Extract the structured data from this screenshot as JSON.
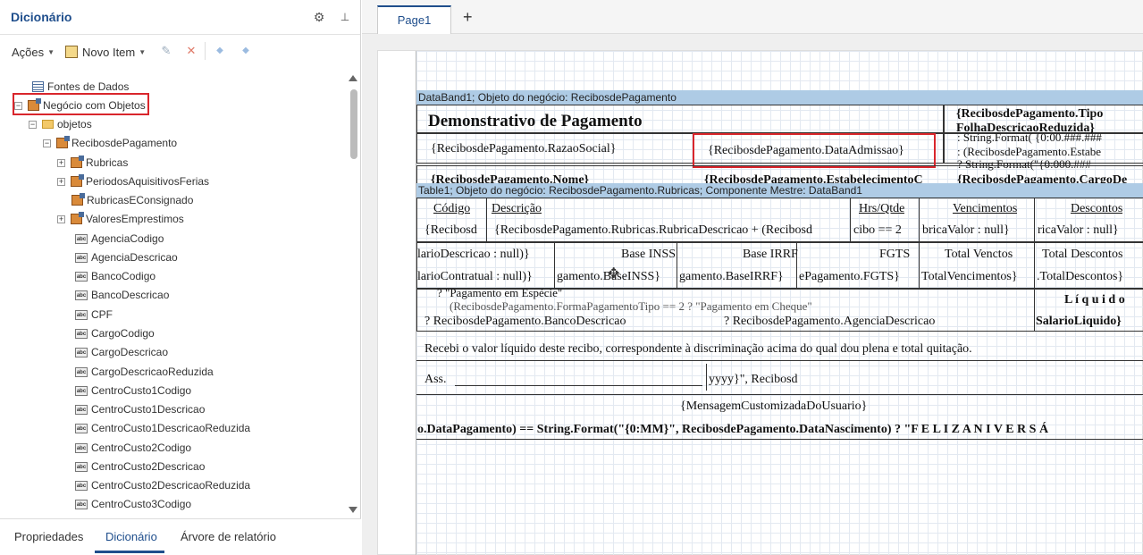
{
  "left_panel": {
    "title": "Dicionário",
    "toolbar": {
      "acoes": "Ações",
      "novo_item": "Novo Item"
    },
    "tree": [
      {
        "label": "Fontes de Dados"
      },
      {
        "label": "Negócio com Objetos"
      },
      {
        "label": "objetos"
      },
      {
        "label": "RecibosdePagamento"
      },
      {
        "label": "Rubricas"
      },
      {
        "label": "PeriodosAquisitivosFerias"
      },
      {
        "label": "RubricasEConsignado"
      },
      {
        "label": "ValoresEmprestimos"
      },
      {
        "label": "AgenciaCodigo"
      },
      {
        "label": "AgenciaDescricao"
      },
      {
        "label": "BancoCodigo"
      },
      {
        "label": "BancoDescricao"
      },
      {
        "label": "CPF"
      },
      {
        "label": "CargoCodigo"
      },
      {
        "label": "CargoDescricao"
      },
      {
        "label": "CargoDescricaoReduzida"
      },
      {
        "label": "CentroCusto1Codigo"
      },
      {
        "label": "CentroCusto1Descricao"
      },
      {
        "label": "CentroCusto1DescricaoReduzida"
      },
      {
        "label": "CentroCusto2Codigo"
      },
      {
        "label": "CentroCusto2Descricao"
      },
      {
        "label": "CentroCusto2DescricaoReduzida"
      },
      {
        "label": "CentroCusto3Codigo"
      }
    ],
    "bottom_tabs": [
      "Propriedades",
      "Dicionário",
      "Árvore de relatório"
    ]
  },
  "report": {
    "page_tab": "Page1",
    "add_tab": "+",
    "databand_header": "DataBand1; Objeto do negócio: RecibosdePagamento",
    "table_header": "Table1; Objeto do negócio: RecibosdePagamento.Rubricas; Componente Mestre: DataBand1",
    "title": "Demonstrativo de Pagamento",
    "tipo_folha_1": "{RecibosdePagamento.Tipo",
    "tipo_folha_2": "FolhaDescricaoReduzida}",
    "razao_social": "{RecibosdePagamento.RazaoSocial}",
    "data_admissao": "{RecibosdePagamento.DataAdmissao}",
    "right_format_1": ": String.Format( {0:00.###.###",
    "right_format_2": ": (RecibosdePagamento.Estabe",
    "right_format_3": "? String.Format(\"{0:000.###",
    "nome": "{RecibosdePagamento.Nome}",
    "estabelecimento": "{RecibosdePagamento.EstabelecimentoC",
    "cargo": "{RecibosdePagamento.CargoDe",
    "col_codigo": "Código",
    "col_descricao": "Descrição",
    "col_hrs": "Hrs/Qtde",
    "col_venc": "Vencimentos",
    "col_desc": "Descontos",
    "row_codigo": "{Recibosd",
    "row_descricao": "{RecibosdePagamento.Rubricas.RubricaDescricao + (Recibosd",
    "row_hrs": "cibo == 2",
    "row_venc": "bricaValor : null}",
    "row_desc": "ricaValor : null}",
    "t_salario_desc": "larioDescricao : null)}",
    "t_base_inss": "Base INSS",
    "t_base_irrf": "Base IRRF",
    "t_fgts": "FGTS",
    "t_total_venc": "Total Venctos",
    "t_total_desc": "Total Descontos",
    "v_salario_contratual": "larioContratual : null)}",
    "v_base_inss": "gamento.BaseINSS}",
    "v_base_irrf": "gamento.BaseIRRF}",
    "v_fgts": "ePagamento.FGTS}",
    "v_total_venc": "TotalVencimentos}",
    "v_total_desc": ".TotalDescontos}",
    "pag_especie": "? \"Pagamento em Espécie\"",
    "forma_pag": "(RecibosdePagamento.FormaPagamentoTipo == 2 ? \"Pagamento em Cheque\"",
    "banco_desc": "? RecibosdePagamento.BancoDescricao",
    "agencia_desc": "? RecibosdePagamento.AgenciaDescricao",
    "liquido": "L í q u i d o",
    "salario_liquido": "SalarioLiquido}",
    "recebi": "Recebi o valor líquido deste recibo, correspondente à discriminação acima do qual dou plena e total quitação.",
    "ass": "Ass.",
    "yyyy": "yyyy}\", Recibosd",
    "mensagem": "{MensagemCustomizadaDoUsuario}",
    "aniversario": "o.DataPagamento) == String.Format(\"{0:MM}\", RecibosdePagamento.DataNascimento) ? \"F E L I Z   A N I V E R S Á"
  },
  "colors": {
    "accent": "#1f4e8c",
    "band": "#aecbe5",
    "highlight": "#d9262c"
  }
}
